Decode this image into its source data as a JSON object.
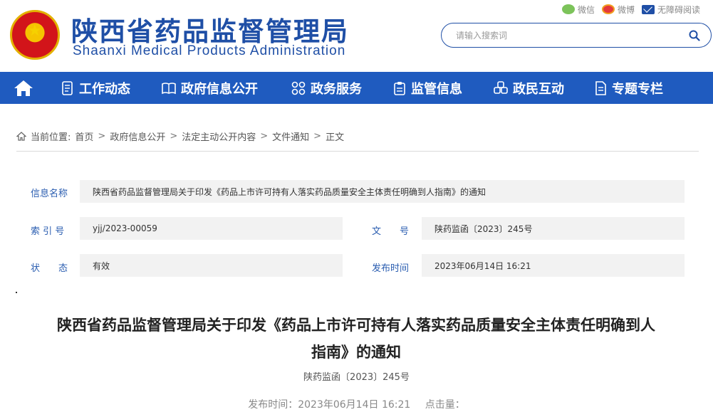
{
  "site": {
    "title_cn": "陕西省药品监督管理局",
    "title_en": "Shaanxi Medical Products Administration"
  },
  "tools": {
    "wechat": "微信",
    "weibo": "微博",
    "accessibility": "无障碍阅读"
  },
  "search": {
    "placeholder": "请输入搜索词"
  },
  "nav": {
    "items": [
      {
        "label": "工作动态",
        "icon": "document-icon"
      },
      {
        "label": "政府信息公开",
        "icon": "book-icon"
      },
      {
        "label": "政务服务",
        "icon": "grid-icon"
      },
      {
        "label": "监管信息",
        "icon": "clipboard-icon"
      },
      {
        "label": "政民互动",
        "icon": "interaction-icon"
      },
      {
        "label": "专题专栏",
        "icon": "file-icon"
      }
    ]
  },
  "breadcrumb": {
    "prefix": "当前位置:",
    "items": [
      "首页",
      "政府信息公开",
      "法定主动公开内容",
      "文件通知",
      "正文"
    ],
    "sep": ">"
  },
  "info": {
    "name_label": "信息名称",
    "name_value": "陕西省药品监督管理局关于印发《药品上市许可持有人落实药品质量安全主体责任明确到人指南》的通知",
    "index_label": "索 引 号",
    "index_value": "yjj/2023-00059",
    "docno_label": "文　　号",
    "docno_value": "陕药监函〔2023〕245号",
    "status_label": "状　　态",
    "status_value": "有效",
    "date_label": "发布时间",
    "date_value": "2023年06月14日 16:21"
  },
  "article": {
    "title_line1": "陕西省药品监督管理局关于印发《药品上市许可持有人落实药品质量安全主体责任明确到人",
    "title_line2": "指南》的通知",
    "doc_number": "陕药监函〔2023〕245号",
    "publish_time": "发布时间：2023年06月14日 16:21",
    "clicks_label": "点击量："
  },
  "colors": {
    "brand": "#1f4fa6",
    "nav_bg": "#1f5bbf",
    "label": "#2a5db0"
  }
}
